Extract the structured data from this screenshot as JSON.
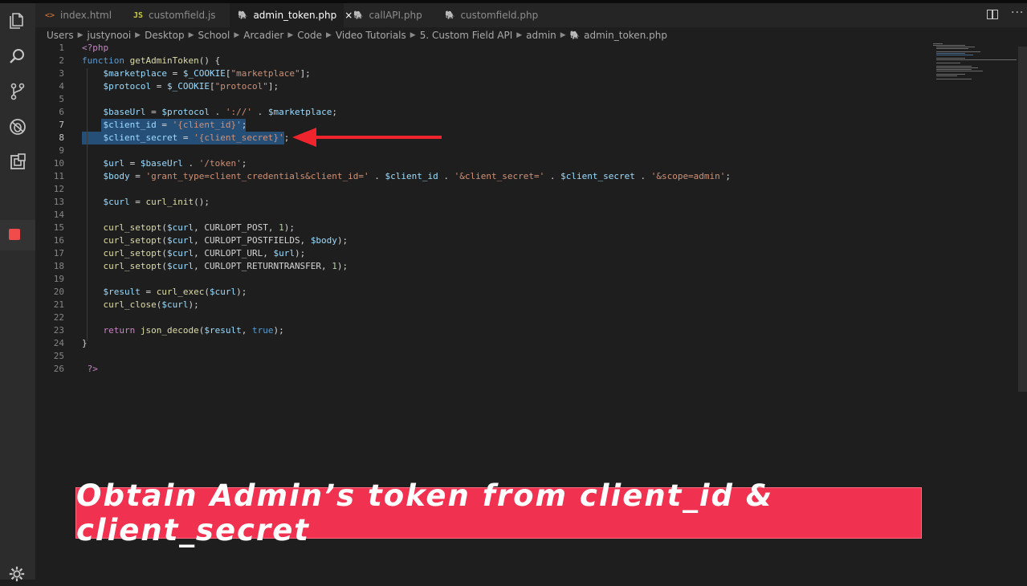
{
  "tabs": [
    {
      "label": "index.html",
      "icon": "<>",
      "icon_color": "#e37933",
      "active": false
    },
    {
      "label": "customfield.js",
      "icon": "JS",
      "icon_color": "#cbcb41",
      "active": false
    },
    {
      "label": "admin_token.php",
      "icon": "php",
      "icon_color": "#9b7fd4",
      "active": true,
      "close": "×"
    },
    {
      "label": "callAPI.php",
      "icon": "php",
      "icon_color": "#9b7fd4",
      "active": false
    },
    {
      "label": "customfield.php",
      "icon": "php",
      "icon_color": "#9b7fd4",
      "active": false
    }
  ],
  "breadcrumb": [
    "Users",
    "justynooi",
    "Desktop",
    "School",
    "Arcadier",
    "Code",
    "Video Tutorials",
    "5. Custom Field API",
    "admin",
    "admin_token.php"
  ],
  "code_lines": [
    {
      "n": "1",
      "t": [
        [
          "c",
          "<?php"
        ]
      ]
    },
    {
      "n": "2",
      "t": [
        [
          "k",
          "function "
        ],
        [
          "f",
          "getAdminToken"
        ],
        [
          "p",
          "() {"
        ]
      ]
    },
    {
      "n": "3",
      "t": [
        [
          "p",
          "    "
        ],
        [
          "v",
          "$marketplace"
        ],
        [
          "p",
          " = "
        ],
        [
          "v",
          "$_COOKIE"
        ],
        [
          "p",
          "["
        ],
        [
          "s",
          "\"marketplace\""
        ],
        [
          "p",
          "];"
        ]
      ]
    },
    {
      "n": "4",
      "t": [
        [
          "p",
          "    "
        ],
        [
          "v",
          "$protocol"
        ],
        [
          "p",
          " = "
        ],
        [
          "v",
          "$_COOKIE"
        ],
        [
          "p",
          "["
        ],
        [
          "s",
          "\"protocol\""
        ],
        [
          "p",
          "];"
        ]
      ]
    },
    {
      "n": "5",
      "t": []
    },
    {
      "n": "6",
      "t": [
        [
          "p",
          "    "
        ],
        [
          "v",
          "$baseUrl"
        ],
        [
          "p",
          " = "
        ],
        [
          "v",
          "$protocol"
        ],
        [
          "p",
          " . "
        ],
        [
          "s",
          "'://'"
        ],
        [
          "p",
          " . "
        ],
        [
          "v",
          "$marketplace"
        ],
        [
          "p",
          ";"
        ]
      ]
    },
    {
      "n": "7",
      "t": [
        [
          "p",
          "    "
        ],
        [
          "v",
          "$client_id"
        ],
        [
          "p",
          " = "
        ],
        [
          "s",
          "'{client_id}'"
        ],
        [
          "p",
          ";"
        ]
      ]
    },
    {
      "n": "8",
      "t": [
        [
          "p",
          "    "
        ],
        [
          "v",
          "$client_secret"
        ],
        [
          "p",
          " = "
        ],
        [
          "s",
          "'{client_secret}'"
        ],
        [
          "p",
          ";"
        ]
      ]
    },
    {
      "n": "9",
      "t": []
    },
    {
      "n": "10",
      "t": [
        [
          "p",
          "    "
        ],
        [
          "v",
          "$url"
        ],
        [
          "p",
          " = "
        ],
        [
          "v",
          "$baseUrl"
        ],
        [
          "p",
          " . "
        ],
        [
          "s",
          "'/token'"
        ],
        [
          "p",
          ";"
        ]
      ]
    },
    {
      "n": "11",
      "t": [
        [
          "p",
          "    "
        ],
        [
          "v",
          "$body"
        ],
        [
          "p",
          " = "
        ],
        [
          "s",
          "'grant_type=client_credentials&client_id='"
        ],
        [
          "p",
          " . "
        ],
        [
          "v",
          "$client_id"
        ],
        [
          "p",
          " . "
        ],
        [
          "s",
          "'&client_secret='"
        ],
        [
          "p",
          " . "
        ],
        [
          "v",
          "$client_secret"
        ],
        [
          "p",
          " . "
        ],
        [
          "s",
          "'&scope=admin'"
        ],
        [
          "p",
          ";"
        ]
      ]
    },
    {
      "n": "12",
      "t": []
    },
    {
      "n": "13",
      "t": [
        [
          "p",
          "    "
        ],
        [
          "v",
          "$curl"
        ],
        [
          "p",
          " = "
        ],
        [
          "f",
          "curl_init"
        ],
        [
          "p",
          "();"
        ]
      ]
    },
    {
      "n": "14",
      "t": []
    },
    {
      "n": "15",
      "t": [
        [
          "p",
          "    "
        ],
        [
          "f",
          "curl_setopt"
        ],
        [
          "p",
          "("
        ],
        [
          "v",
          "$curl"
        ],
        [
          "p",
          ", CURLOPT_POST, "
        ],
        [
          "n",
          "1"
        ],
        [
          "p",
          ");"
        ]
      ]
    },
    {
      "n": "16",
      "t": [
        [
          "p",
          "    "
        ],
        [
          "f",
          "curl_setopt"
        ],
        [
          "p",
          "("
        ],
        [
          "v",
          "$curl"
        ],
        [
          "p",
          ", CURLOPT_POSTFIELDS, "
        ],
        [
          "v",
          "$body"
        ],
        [
          "p",
          ");"
        ]
      ]
    },
    {
      "n": "17",
      "t": [
        [
          "p",
          "    "
        ],
        [
          "f",
          "curl_setopt"
        ],
        [
          "p",
          "("
        ],
        [
          "v",
          "$curl"
        ],
        [
          "p",
          ", CURLOPT_URL, "
        ],
        [
          "v",
          "$url"
        ],
        [
          "p",
          ");"
        ]
      ]
    },
    {
      "n": "18",
      "t": [
        [
          "p",
          "    "
        ],
        [
          "f",
          "curl_setopt"
        ],
        [
          "p",
          "("
        ],
        [
          "v",
          "$curl"
        ],
        [
          "p",
          ", CURLOPT_RETURNTRANSFER, "
        ],
        [
          "n",
          "1"
        ],
        [
          "p",
          ");"
        ]
      ]
    },
    {
      "n": "19",
      "t": []
    },
    {
      "n": "20",
      "t": [
        [
          "p",
          "    "
        ],
        [
          "v",
          "$result"
        ],
        [
          "p",
          " = "
        ],
        [
          "f",
          "curl_exec"
        ],
        [
          "p",
          "("
        ],
        [
          "v",
          "$curl"
        ],
        [
          "p",
          ");"
        ]
      ]
    },
    {
      "n": "21",
      "t": [
        [
          "p",
          "    "
        ],
        [
          "f",
          "curl_close"
        ],
        [
          "p",
          "("
        ],
        [
          "v",
          "$curl"
        ],
        [
          "p",
          ");"
        ]
      ]
    },
    {
      "n": "22",
      "t": []
    },
    {
      "n": "23",
      "t": [
        [
          "p",
          "    "
        ],
        [
          "c",
          "return "
        ],
        [
          "f",
          "json_decode"
        ],
        [
          "p",
          "("
        ],
        [
          "v",
          "$result"
        ],
        [
          "p",
          ", "
        ],
        [
          "k",
          "true"
        ],
        [
          "p",
          ");"
        ]
      ]
    },
    {
      "n": "24",
      "t": [
        [
          "p",
          "}"
        ]
      ]
    },
    {
      "n": "25",
      "t": []
    },
    {
      "n": "26",
      "t": [
        [
          "p",
          " "
        ],
        [
          "c",
          "?>"
        ]
      ]
    }
  ],
  "banner": {
    "text": "Obtain Admin’s token from client_id & client_secret"
  },
  "colors": {
    "banner": "#f0314f",
    "arrow": "#f0242c",
    "selection": "#264f78",
    "stop": "#f14c4c"
  },
  "icons": {
    "activity": [
      "files-icon",
      "search-icon",
      "source-control-icon",
      "debug-icon",
      "extensions-icon",
      "stop-icon",
      "gear-icon"
    ]
  }
}
